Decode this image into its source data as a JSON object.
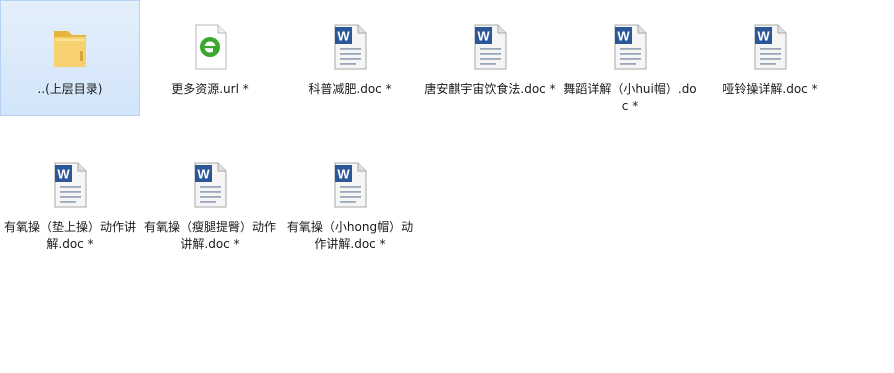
{
  "files": [
    {
      "name": "..(上层目录)",
      "icon": "folder-icon",
      "selected": true
    },
    {
      "name": "更多资源.url *",
      "icon": "url-shortcut-icon",
      "selected": false
    },
    {
      "name": "科普减肥.doc *",
      "icon": "word-doc-icon",
      "selected": false
    },
    {
      "name": "唐安麒宇宙饮食法.doc *",
      "icon": "word-doc-icon",
      "selected": false
    },
    {
      "name": "舞蹈详解（小hui帽）.doc *",
      "icon": "word-doc-icon",
      "selected": false
    },
    {
      "name": "哑铃操详解.doc *",
      "icon": "word-doc-icon",
      "selected": false
    },
    {
      "name": "有氧操（垫上操）动作讲解.doc *",
      "icon": "word-doc-icon",
      "selected": false
    },
    {
      "name": "有氧操（瘦腿提臀）动作讲解.doc *",
      "icon": "word-doc-icon",
      "selected": false
    },
    {
      "name": "有氧操（小hong帽）动作讲解.doc *",
      "icon": "word-doc-icon",
      "selected": false
    }
  ],
  "colors": {
    "selection_bg": "#d8e8fb",
    "selection_border": "#b6d2f2",
    "folder": "#f5c85a",
    "word_blue": "#2b5797",
    "url_green": "#3aa72f"
  }
}
